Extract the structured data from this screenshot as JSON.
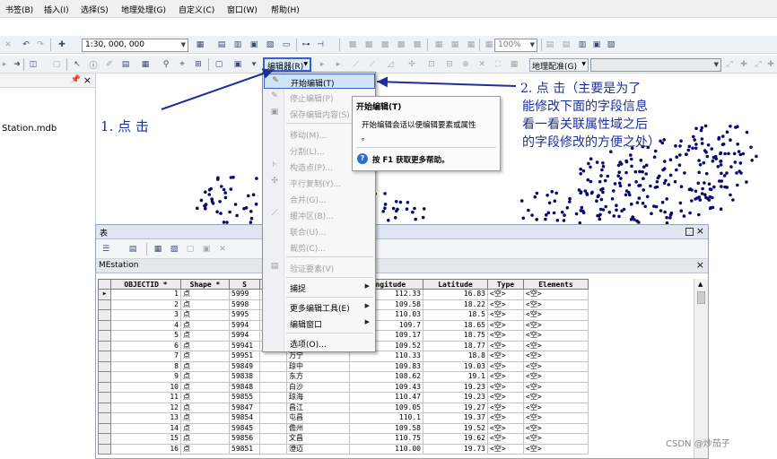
{
  "menu": [
    "书签(B)",
    "插入(I)",
    "选择(S)",
    "地理处理(G)",
    "自定义(C)",
    "窗口(W)",
    "帮助(H)"
  ],
  "scale_value": "1:30, 000, 000",
  "zoom_value": "100%",
  "editor_button": "编辑器(R)",
  "georef_button": "地理配准(G)",
  "left_panel": {
    "pin": "📌",
    "close": "×",
    "file_label": "Station.mdb"
  },
  "editor_menu": {
    "start": "开始编辑(T)",
    "stop": "停止编辑(P)",
    "save": "保存编辑内容(S)",
    "move": "移动(M)...",
    "split": "分割(L)...",
    "construct": "构造点(P)...",
    "copy_parallel": "平行复制(Y)...",
    "merge": "合并(G)...",
    "buffer": "缓冲区(B)...",
    "union": "联合(U)...",
    "clip": "裁剪(C)...",
    "validate": "验证要素(V)",
    "snapping": "捕捉",
    "more_tools": "更多编辑工具(E)",
    "editing_windows": "编辑窗口",
    "options": "选项(O)..."
  },
  "tooltip": {
    "title": "开始编辑(T)",
    "body_line1": "开始编辑会话以便编辑要素或属性",
    "body_line2": "。",
    "help": "按 F1 获取更多帮助。"
  },
  "annotations": {
    "step1": "1. 点 击",
    "step2_line1": "2. 点 击（主要是为了",
    "step2_line2": "能修改下面的字段信息",
    "step2_line3": "看一看关联属性域之后",
    "step2_line4": "的字段修改的方便之处）"
  },
  "table_window": {
    "title": "表",
    "tab": "MEstation",
    "close_icon": "×",
    "columns": [
      "OBJECTID *",
      "Shape *",
      "S",
      "",
      "m",
      "Longitude",
      "Latitude",
      "Type",
      "Elements"
    ],
    "rows": [
      [
        "1",
        "点",
        "5999",
        "",
        "",
        "112.33",
        "16.83",
        "<空>",
        "<空>"
      ],
      [
        "2",
        "点",
        "5998",
        "",
        "",
        "109.58",
        "18.22",
        "<空>",
        "<空>"
      ],
      [
        "3",
        "点",
        "5995",
        "",
        "",
        "110.03",
        "18.5",
        "<空>",
        "<空>"
      ],
      [
        "4",
        "点",
        "5994",
        "",
        "",
        "109.7",
        "18.65",
        "<空>",
        "<空>"
      ],
      [
        "5",
        "点",
        "5994",
        "",
        "",
        "109.17",
        "18.75",
        "<空>",
        "<空>"
      ],
      [
        "6",
        "点",
        "59941",
        "",
        "",
        "109.52",
        "18.77",
        "<空>",
        "<空>"
      ],
      [
        "7",
        "点",
        "59951",
        "",
        "万宁",
        "110.33",
        "18.8",
        "<空>",
        "<空>"
      ],
      [
        "8",
        "点",
        "59849",
        "",
        "琼中",
        "109.83",
        "19.03",
        "<空>",
        "<空>"
      ],
      [
        "9",
        "点",
        "59838",
        "",
        "东方",
        "108.62",
        "19.1",
        "<空>",
        "<空>"
      ],
      [
        "10",
        "点",
        "59848",
        "",
        "白沙",
        "109.43",
        "19.23",
        "<空>",
        "<空>"
      ],
      [
        "11",
        "点",
        "59855",
        "",
        "琼海",
        "110.47",
        "19.23",
        "<空>",
        "<空>"
      ],
      [
        "12",
        "点",
        "59847",
        "",
        "昌江",
        "109.05",
        "19.27",
        "<空>",
        "<空>"
      ],
      [
        "13",
        "点",
        "59854",
        "",
        "屯昌",
        "110.1",
        "19.37",
        "<空>",
        "<空>"
      ],
      [
        "14",
        "点",
        "59845",
        "",
        "儋州",
        "109.58",
        "19.52",
        "<空>",
        "<空>"
      ],
      [
        "15",
        "点",
        "59856",
        "",
        "文昌",
        "110.75",
        "19.62",
        "<空>",
        "<空>"
      ],
      [
        "16",
        "点",
        "59851",
        "",
        "澄迈",
        "110.00",
        "19.73",
        "<空>",
        "<空>"
      ]
    ]
  },
  "watermark": "CSDN @炒茄子",
  "colors": {
    "annotation": "#1e2f9a",
    "highlight_border": "#3b5fcf",
    "map_dots": "#0a0a6e"
  }
}
